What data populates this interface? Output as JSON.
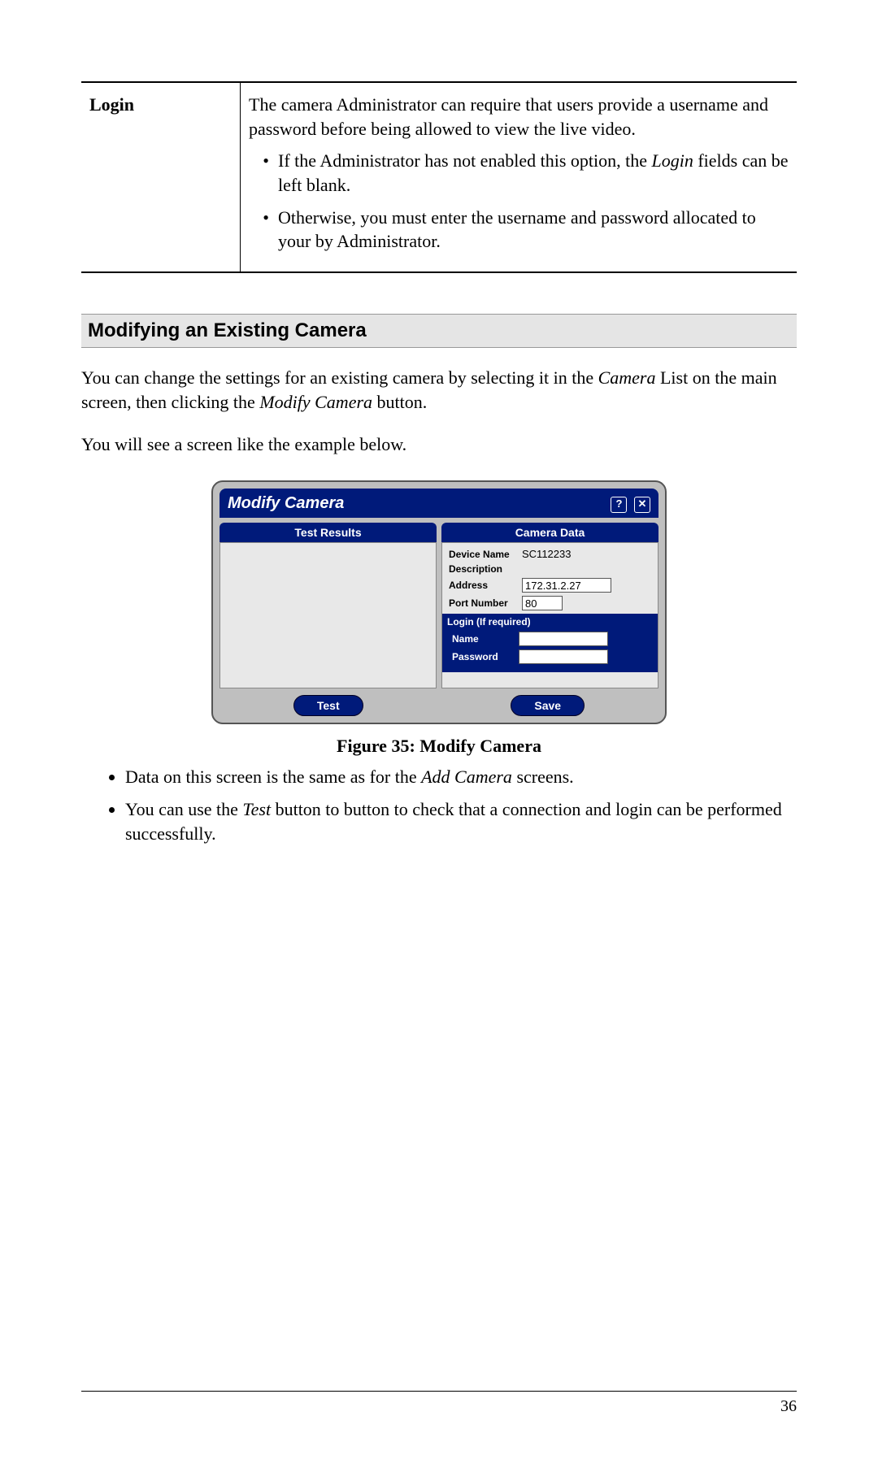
{
  "table": {
    "left": "Login",
    "intro": "The camera Administrator can require that users provide a username and password before being allowed to view the live video.",
    "bullets": [
      {
        "pre": "If the Administrator has not enabled this option, the ",
        "ital": "Login",
        "post": " fields can be left blank."
      },
      {
        "pre": "Otherwise, you must enter the username and password allocated to your by Administrator.",
        "ital": "",
        "post": ""
      }
    ]
  },
  "section_heading": "Modifying an Existing Camera",
  "para1": {
    "a": "You can change the settings for an existing camera by selecting it in the ",
    "i1": "Camera",
    "b": " List on the main screen, then clicking the ",
    "i2": "Modify Camera",
    "c": " button."
  },
  "para2": "You will see a screen like the example below.",
  "dialog": {
    "title": "Modify Camera",
    "help_icon": "?",
    "close_icon": "✕",
    "left_header": "Test Results",
    "right_header": "Camera Data",
    "camera": {
      "device_name_label": "Device Name",
      "device_name": "SC112233",
      "description_label": "Description",
      "description": "",
      "address_label": "Address",
      "address": "172.31.2.27",
      "port_label": "Port Number",
      "port": "80",
      "login_header": "Login (If required)",
      "name_label": "Name",
      "name": "",
      "password_label": "Password",
      "password": ""
    },
    "test_btn": "Test",
    "save_btn": "Save"
  },
  "fig_caption": "Figure 35: Modify Camera",
  "post_bullets": [
    {
      "pre": "Data on this screen is the same as for the ",
      "ital": "Add Camera",
      "post": " screens."
    },
    {
      "pre": "You can use the ",
      "ital": "Test",
      "post": " button to button to check that a connection and login can be performed successfully."
    }
  ],
  "page_number": "36"
}
